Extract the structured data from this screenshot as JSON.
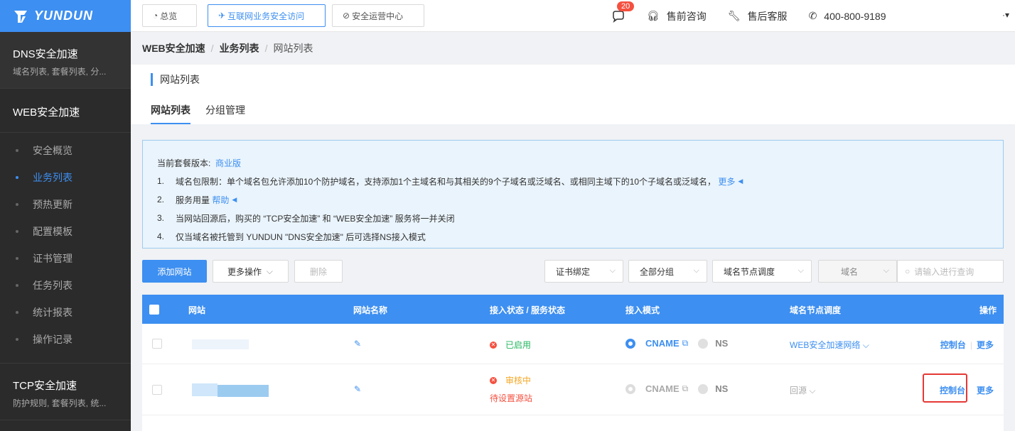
{
  "brand": {
    "name": "YUNDUN"
  },
  "sidebar": {
    "groups": [
      {
        "title": "DNS安全加速",
        "subtitle": "域名列表, 套餐列表, 分..."
      },
      {
        "title": "WEB安全加速"
      },
      {
        "title": "TCP安全加速",
        "subtitle": "防护规则, 套餐列表, 统..."
      }
    ],
    "items": [
      "安全概览",
      "业务列表",
      "预热更新",
      "配置模板",
      "证书管理",
      "任务列表",
      "统计报表",
      "操作记录"
    ],
    "active_item": "业务列表"
  },
  "topbar": {
    "overview": "总览",
    "secure_access": "互联网业务安全访问",
    "soc": "安全运营中心",
    "message_count": "20",
    "presales": "售前咨询",
    "aftersales": "售后客服",
    "phone": "400-800-9189",
    "end_mark": "·▾"
  },
  "breadcrumb": {
    "level1": "WEB安全加速",
    "level2": "业务列表",
    "current": "网站列表",
    "sep": "/"
  },
  "panel": {
    "title": "网站列表",
    "tabs": [
      "网站列表",
      "分组管理"
    ]
  },
  "notice": {
    "plan_label": "当前套餐版本:",
    "plan_value": "商业版",
    "lines": [
      {
        "num": "1.",
        "text": "域名包限制：单个域名包允许添加10个防护域名，支持添加1个主域名和与其相关的9个子域名或泛域名、或相同主域下的10个子域名或泛域名，",
        "link": "更多"
      },
      {
        "num": "2.",
        "text": "服务用量",
        "link": "帮助"
      },
      {
        "num": "3.",
        "text": "当网站回源后，购买的 “TCP安全加速” 和 “WEB安全加速” 服务将一并关闭"
      },
      {
        "num": "4.",
        "text": "仅当域名被托管到 YUNDUN \"DNS安全加速\" 后可选择NS接入模式"
      }
    ]
  },
  "toolbar": {
    "add_site": "添加网站",
    "more_ops": "更多操作",
    "delete": "删除",
    "cert_bind": "证书绑定",
    "all_groups": "全部分组",
    "node_schedule": "域名节点调度",
    "domain": "域名",
    "search_placeholder": "请输入进行查询"
  },
  "table": {
    "headers": [
      "网站",
      "网站名称",
      "接入状态 / 服务状态",
      "接入模式",
      "域名节点调度",
      "操作"
    ],
    "rows": [
      {
        "status": "已启用",
        "status_sub": "",
        "mode_cname": "CNAME",
        "mode_ns": "NS",
        "schedule": "WEB安全加速网络",
        "op_console": "控制台",
        "op_more": "更多"
      },
      {
        "status": "审核中",
        "status_sub": "待设置源站",
        "mode_cname": "CNAME",
        "mode_ns": "NS",
        "schedule": "回源",
        "op_console": "控制台",
        "op_more": "更多"
      }
    ]
  },
  "colors": {
    "accent": "#3d8ff1",
    "sidebar": "#2b2b2b",
    "success": "#23b55e",
    "warning": "#f5a623",
    "danger": "#f5503f"
  }
}
